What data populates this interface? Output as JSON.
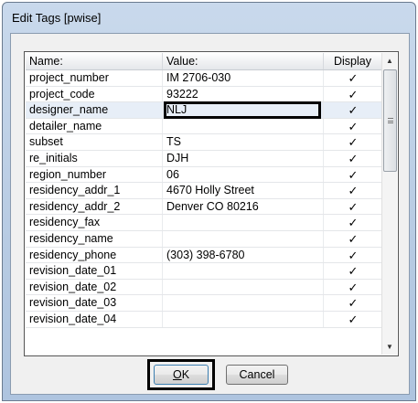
{
  "window": {
    "title": "Edit Tags [pwise]"
  },
  "grid": {
    "columns": [
      "Name:",
      "Value:",
      "Display"
    ],
    "rows": [
      {
        "name": "project_number",
        "value": "IM 2706-030",
        "display": "✓"
      },
      {
        "name": "project_code",
        "value": "93222",
        "display": "✓"
      },
      {
        "name": "designer_name",
        "value": "NLJ",
        "display": "✓"
      },
      {
        "name": "detailer_name",
        "value": "",
        "display": "✓"
      },
      {
        "name": "subset",
        "value": "TS",
        "display": "✓"
      },
      {
        "name": "re_initials",
        "value": "DJH",
        "display": "✓"
      },
      {
        "name": "region_number",
        "value": "06",
        "display": "✓"
      },
      {
        "name": "residency_addr_1",
        "value": "4670 Holly Street",
        "display": "✓"
      },
      {
        "name": "residency_addr_2",
        "value": "Denver CO 80216",
        "display": "✓"
      },
      {
        "name": "residency_fax",
        "value": "",
        "display": "✓"
      },
      {
        "name": "residency_name",
        "value": "",
        "display": "✓"
      },
      {
        "name": "residency_phone",
        "value": "(303) 398-6780",
        "display": "✓"
      },
      {
        "name": "revision_date_01",
        "value": "",
        "display": "✓"
      },
      {
        "name": "revision_date_02",
        "value": "",
        "display": "✓"
      },
      {
        "name": "revision_date_03",
        "value": "",
        "display": "✓"
      },
      {
        "name": "revision_date_04",
        "value": "",
        "display": "✓"
      }
    ],
    "selected_index": 2
  },
  "scrollbar": {
    "up_icon": "▲",
    "down_icon": "▼"
  },
  "buttons": {
    "ok_mnemonic": "O",
    "ok_rest": "K",
    "cancel_label": "Cancel"
  }
}
